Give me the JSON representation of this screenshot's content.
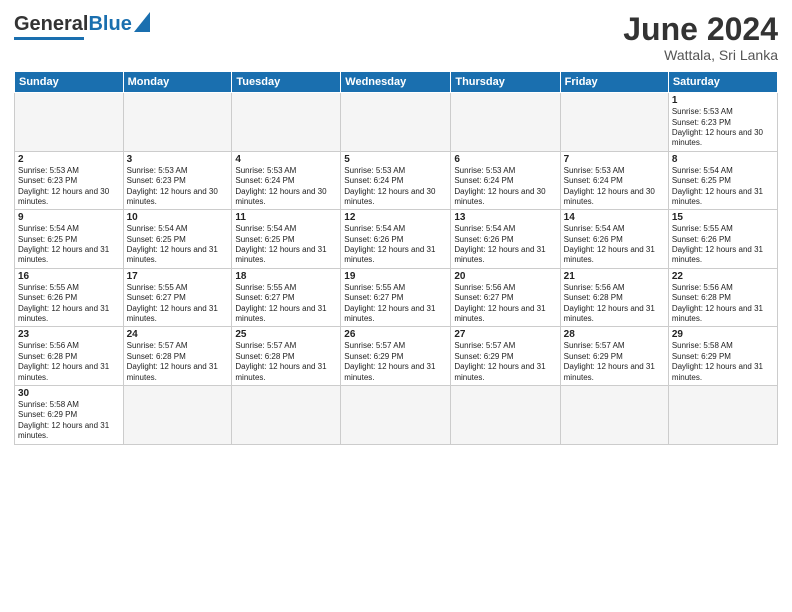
{
  "header": {
    "logo_general": "General",
    "logo_blue": "Blue",
    "title": "June 2024",
    "subtitle": "Wattala, Sri Lanka"
  },
  "weekdays": [
    "Sunday",
    "Monday",
    "Tuesday",
    "Wednesday",
    "Thursday",
    "Friday",
    "Saturday"
  ],
  "weeks": [
    [
      {
        "day": "",
        "empty": true
      },
      {
        "day": "",
        "empty": true
      },
      {
        "day": "",
        "empty": true
      },
      {
        "day": "",
        "empty": true
      },
      {
        "day": "",
        "empty": true
      },
      {
        "day": "",
        "empty": true
      },
      {
        "day": "1",
        "sunrise": "5:53 AM",
        "sunset": "6:23 PM",
        "daylight": "12 hours and 30 minutes."
      }
    ],
    [
      {
        "day": "2",
        "sunrise": "5:53 AM",
        "sunset": "6:23 PM",
        "daylight": "12 hours and 30 minutes."
      },
      {
        "day": "3",
        "sunrise": "5:53 AM",
        "sunset": "6:23 PM",
        "daylight": "12 hours and 30 minutes."
      },
      {
        "day": "4",
        "sunrise": "5:53 AM",
        "sunset": "6:24 PM",
        "daylight": "12 hours and 30 minutes."
      },
      {
        "day": "5",
        "sunrise": "5:53 AM",
        "sunset": "6:24 PM",
        "daylight": "12 hours and 30 minutes."
      },
      {
        "day": "6",
        "sunrise": "5:53 AM",
        "sunset": "6:24 PM",
        "daylight": "12 hours and 30 minutes."
      },
      {
        "day": "7",
        "sunrise": "5:53 AM",
        "sunset": "6:24 PM",
        "daylight": "12 hours and 30 minutes."
      },
      {
        "day": "8",
        "sunrise": "5:54 AM",
        "sunset": "6:25 PM",
        "daylight": "12 hours and 31 minutes."
      }
    ],
    [
      {
        "day": "9",
        "sunrise": "5:54 AM",
        "sunset": "6:25 PM",
        "daylight": "12 hours and 31 minutes."
      },
      {
        "day": "10",
        "sunrise": "5:54 AM",
        "sunset": "6:25 PM",
        "daylight": "12 hours and 31 minutes."
      },
      {
        "day": "11",
        "sunrise": "5:54 AM",
        "sunset": "6:25 PM",
        "daylight": "12 hours and 31 minutes."
      },
      {
        "day": "12",
        "sunrise": "5:54 AM",
        "sunset": "6:26 PM",
        "daylight": "12 hours and 31 minutes."
      },
      {
        "day": "13",
        "sunrise": "5:54 AM",
        "sunset": "6:26 PM",
        "daylight": "12 hours and 31 minutes."
      },
      {
        "day": "14",
        "sunrise": "5:54 AM",
        "sunset": "6:26 PM",
        "daylight": "12 hours and 31 minutes."
      },
      {
        "day": "15",
        "sunrise": "5:55 AM",
        "sunset": "6:26 PM",
        "daylight": "12 hours and 31 minutes."
      }
    ],
    [
      {
        "day": "16",
        "sunrise": "5:55 AM",
        "sunset": "6:26 PM",
        "daylight": "12 hours and 31 minutes."
      },
      {
        "day": "17",
        "sunrise": "5:55 AM",
        "sunset": "6:27 PM",
        "daylight": "12 hours and 31 minutes."
      },
      {
        "day": "18",
        "sunrise": "5:55 AM",
        "sunset": "6:27 PM",
        "daylight": "12 hours and 31 minutes."
      },
      {
        "day": "19",
        "sunrise": "5:55 AM",
        "sunset": "6:27 PM",
        "daylight": "12 hours and 31 minutes."
      },
      {
        "day": "20",
        "sunrise": "5:56 AM",
        "sunset": "6:27 PM",
        "daylight": "12 hours and 31 minutes."
      },
      {
        "day": "21",
        "sunrise": "5:56 AM",
        "sunset": "6:28 PM",
        "daylight": "12 hours and 31 minutes."
      },
      {
        "day": "22",
        "sunrise": "5:56 AM",
        "sunset": "6:28 PM",
        "daylight": "12 hours and 31 minutes."
      }
    ],
    [
      {
        "day": "23",
        "sunrise": "5:56 AM",
        "sunset": "6:28 PM",
        "daylight": "12 hours and 31 minutes."
      },
      {
        "day": "24",
        "sunrise": "5:57 AM",
        "sunset": "6:28 PM",
        "daylight": "12 hours and 31 minutes."
      },
      {
        "day": "25",
        "sunrise": "5:57 AM",
        "sunset": "6:28 PM",
        "daylight": "12 hours and 31 minutes."
      },
      {
        "day": "26",
        "sunrise": "5:57 AM",
        "sunset": "6:29 PM",
        "daylight": "12 hours and 31 minutes."
      },
      {
        "day": "27",
        "sunrise": "5:57 AM",
        "sunset": "6:29 PM",
        "daylight": "12 hours and 31 minutes."
      },
      {
        "day": "28",
        "sunrise": "5:57 AM",
        "sunset": "6:29 PM",
        "daylight": "12 hours and 31 minutes."
      },
      {
        "day": "29",
        "sunrise": "5:58 AM",
        "sunset": "6:29 PM",
        "daylight": "12 hours and 31 minutes."
      }
    ],
    [
      {
        "day": "30",
        "sunrise": "5:58 AM",
        "sunset": "6:29 PM",
        "daylight": "12 hours and 31 minutes."
      },
      {
        "day": "",
        "empty": true
      },
      {
        "day": "",
        "empty": true
      },
      {
        "day": "",
        "empty": true
      },
      {
        "day": "",
        "empty": true
      },
      {
        "day": "",
        "empty": true
      },
      {
        "day": "",
        "empty": true
      }
    ]
  ]
}
